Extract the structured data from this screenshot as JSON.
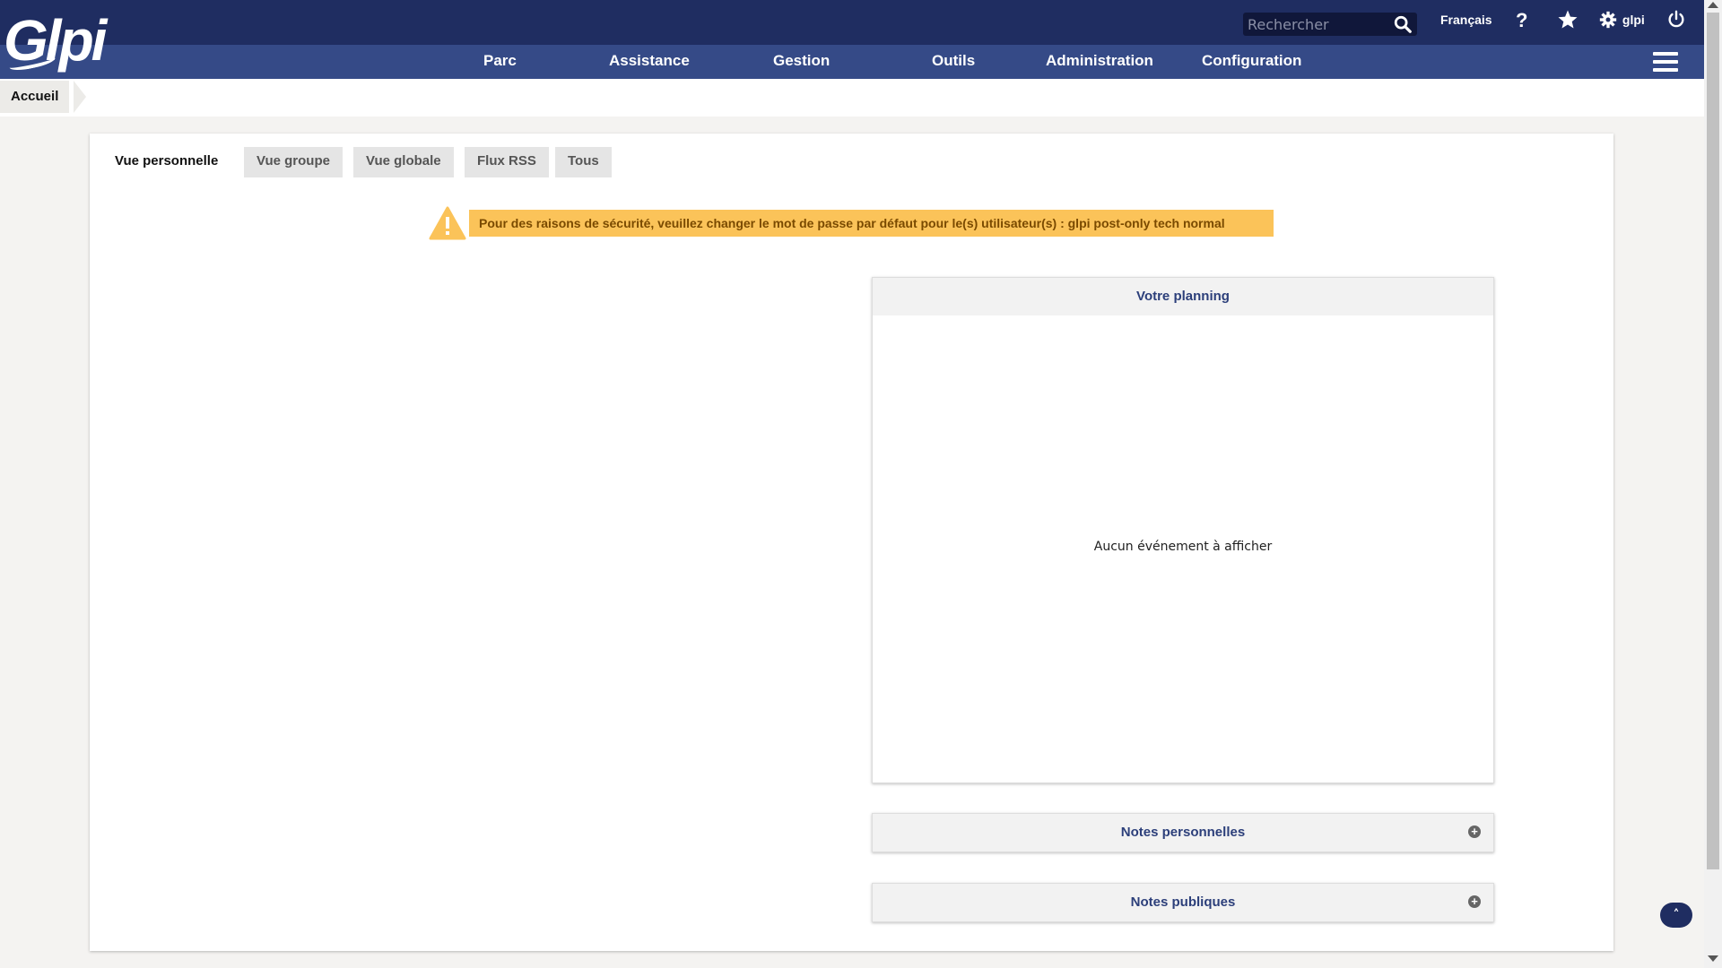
{
  "app": {
    "logo_text": "Glpi"
  },
  "header": {
    "search_placeholder": "Rechercher",
    "language": "Français",
    "help_label": "?",
    "user_name": "glpi"
  },
  "nav": {
    "items": [
      "Parc",
      "Assistance",
      "Gestion",
      "Outils",
      "Administration",
      "Configuration"
    ]
  },
  "breadcrumb": {
    "home": "Accueil"
  },
  "tabs": [
    "Vue personnelle",
    "Vue groupe",
    "Vue globale",
    "Flux RSS",
    "Tous"
  ],
  "active_tab": "Vue personnelle",
  "warning": {
    "message": "Pour des raisons de sécurité, veuillez changer le mot de passe par défaut pour le(s) utilisateur(s) : glpi post-only tech normal"
  },
  "planning": {
    "title": "Votre planning",
    "empty_text": "Aucun événement à afficher"
  },
  "notes": {
    "personal": "Notes personnelles",
    "public": "Notes publiques",
    "expand_symbol": "+"
  },
  "back_to_top_symbol": "˄",
  "colors": {
    "header_dark": "#1f2d61",
    "header_nav": "#354a87",
    "warning_bg": "#fbc359",
    "title_blue": "#2c3f7a"
  }
}
